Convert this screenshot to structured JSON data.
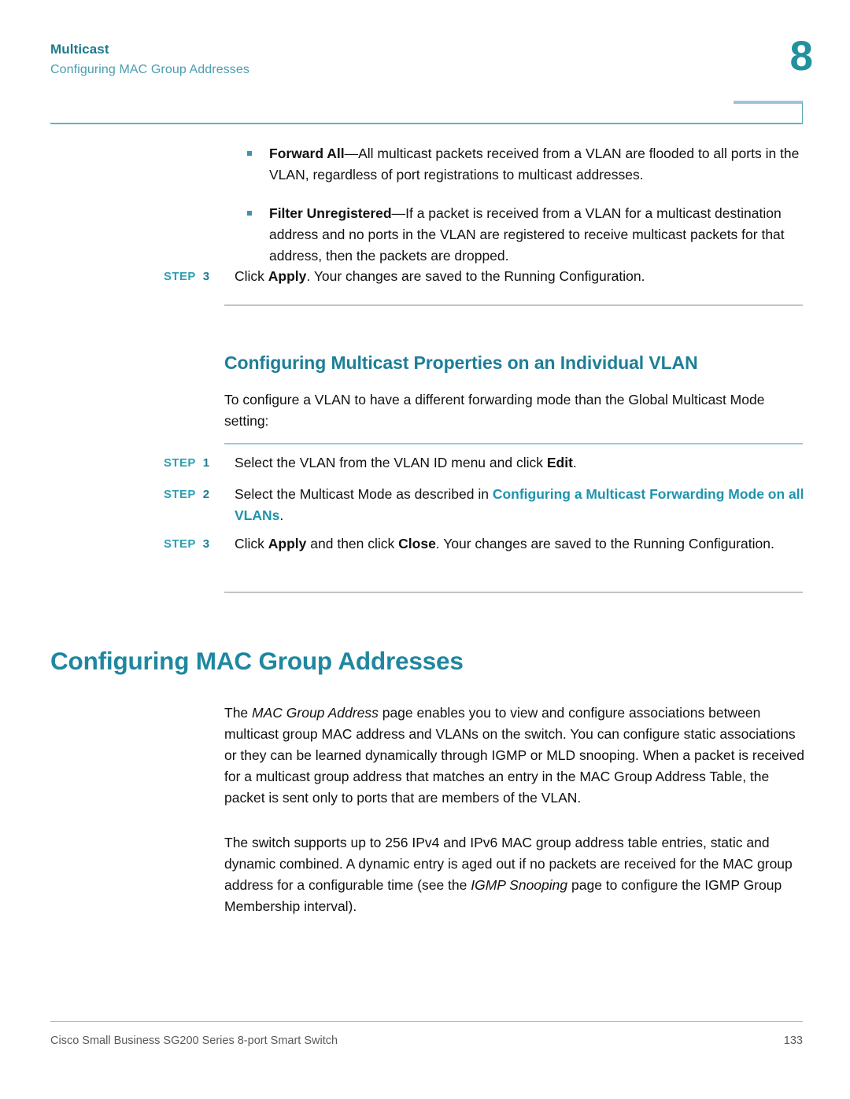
{
  "header": {
    "chapter_title": "Multicast",
    "section_title": "Configuring MAC Group Addresses",
    "chapter_number": "8"
  },
  "bullets": [
    {
      "term": "Forward All",
      "dash": "—",
      "text": "All multicast packets received from a VLAN are flooded to all ports in the VLAN, regardless of port registrations to multicast addresses."
    },
    {
      "term": "Filter Unregistered",
      "dash": "—",
      "text": "If a packet is received from a VLAN for a multicast destination address and no ports in the VLAN are registered to receive multicast packets for that address, then the packets are dropped."
    }
  ],
  "step_apply": {
    "label": "STEP",
    "number": "3",
    "text_pre": "Click ",
    "bold": "Apply",
    "text_post": ". Your changes are saved to the Running Configuration."
  },
  "section_vlan": {
    "heading": "Configuring Multicast Properties on an Individual VLAN",
    "intro": "To configure a VLAN to have a different forwarding mode than the Global Multicast Mode setting:",
    "steps": [
      {
        "label": "STEP",
        "number": "1",
        "text_pre": "Select the VLAN from the VLAN ID menu and click ",
        "bold": "Edit",
        "text_post": "."
      },
      {
        "label": "STEP",
        "number": "2",
        "text_pre": "Select the Multicast Mode as described in ",
        "xref": "Configuring a Multicast Forwarding Mode on all VLANs",
        "text_post": "."
      },
      {
        "label": "STEP",
        "number": "3",
        "text_pre": "Click ",
        "bold": "Apply",
        "text_mid": " and then click ",
        "bold2": "Close",
        "text_post": ". Your changes are saved to the Running Configuration."
      }
    ]
  },
  "section_mac": {
    "heading": "Configuring MAC Group Addresses",
    "paragraph1_pre": "The ",
    "paragraph1_italic": "MAC Group Address",
    "paragraph1_post": " page enables you to view and configure associations between multicast group MAC address and VLANs on the switch. You can configure static associations or they can be learned dynamically through IGMP or MLD snooping. When a packet is received for a multicast group address that matches an entry in the MAC Group Address Table, the packet is sent only to ports that are members of the VLAN.",
    "paragraph2_pre": "The switch supports up to 256 IPv4 and IPv6 MAC group address table entries, static and dynamic combined. A dynamic entry is aged out if no packets are received for the MAC group address for a configurable time (see the ",
    "paragraph2_italic": "IGMP Snooping",
    "paragraph2_post": " page to configure the IGMP Group Membership interval)."
  },
  "footer": {
    "left": "Cisco Small Business SG200 Series 8-port Smart Switch",
    "page_number": "133"
  },
  "colors": {
    "heading_teal": "#1f87a0",
    "accent_teal": "#2e9fb5",
    "rule_gray": "#c3c3c3",
    "rule_teal": "#97ccd8"
  }
}
